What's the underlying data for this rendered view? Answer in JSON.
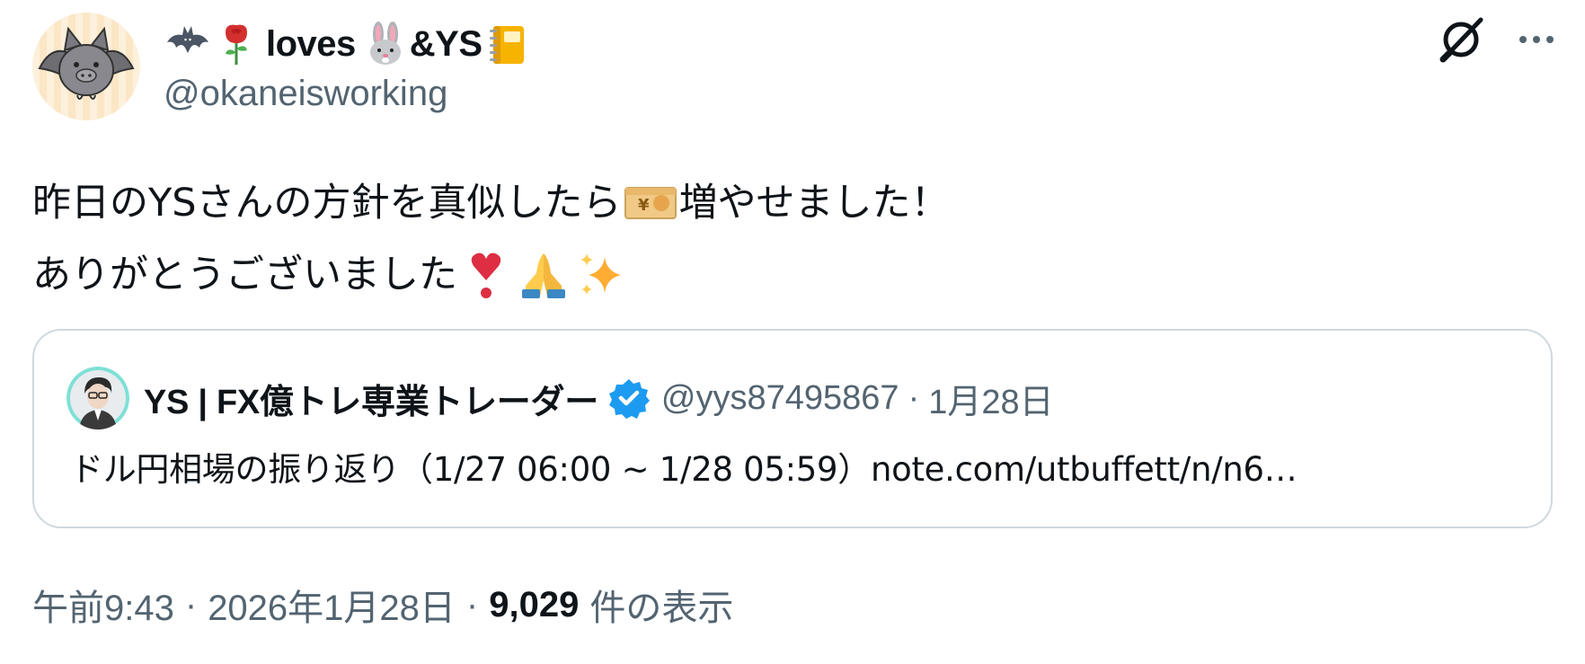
{
  "author": {
    "name_part1": "loves",
    "name_part2": "&YS",
    "handle": "@okaneisworking",
    "name_emojis": [
      "bat",
      "rose",
      "rabbit-face",
      "notebook-with-decorative-cover"
    ]
  },
  "tweet": {
    "line1_before": "昨日のYSさんの方針を真似したら",
    "line1_after": "増やせました！",
    "line2": "ありがとうございました",
    "inline_emojis": [
      "yen-banknote",
      "heavy-heart-exclamation",
      "folded-hands",
      "sparkles"
    ]
  },
  "quote": {
    "name": "YS | FX億トレ専業トレーダー",
    "handle": "@yys87495867",
    "separator": "·",
    "date": "1月28日",
    "text": "ドル円相場の振り返り（1/27 06:00 ~ 1/28 05:59）note.com/utbuffett/n/n6…"
  },
  "footer": {
    "time": "午前9:43",
    "date": "2026年1月28日",
    "separator": "·",
    "views": "9,029",
    "views_label": "件の表示"
  },
  "icons": {
    "grok": "grok-icon",
    "more": "more-horizontal-icon",
    "verified": "verified-badge-icon"
  },
  "colors": {
    "text_primary": "#0f1419",
    "text_secondary": "#536471",
    "border": "#cfd9de",
    "verified_blue": "#1d9bf0"
  }
}
